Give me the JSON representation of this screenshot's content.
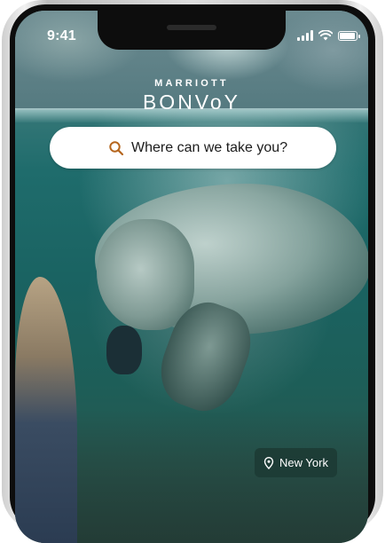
{
  "status_bar": {
    "time": "9:41",
    "battery_level": 0.85
  },
  "logo": {
    "top": "MARRIOTT",
    "main": "BONVoY"
  },
  "search": {
    "placeholder": "Where can we take you?",
    "icon": "search-icon"
  },
  "location": {
    "label": "New York",
    "icon": "location-pin-icon"
  },
  "colors": {
    "search_icon": "#b5651d",
    "chip_bg": "#1c3a34"
  }
}
